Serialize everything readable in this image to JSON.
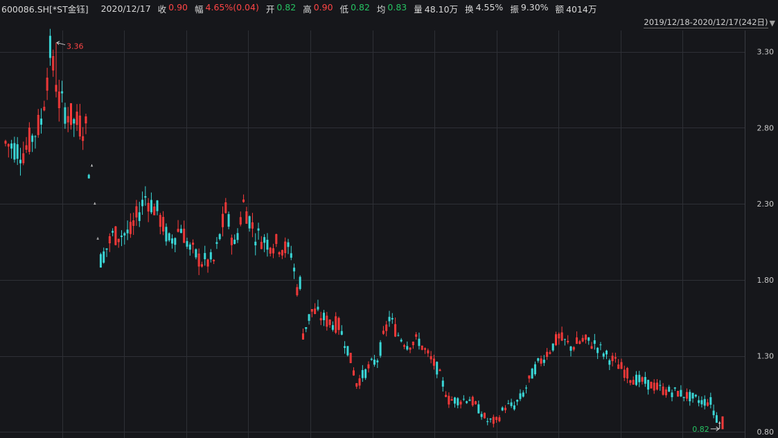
{
  "header": {
    "symbol": "600086.SH[*ST金钰]",
    "date": "2020/12/17",
    "fields": [
      {
        "label": "收",
        "value": "0.90",
        "tone": "up"
      },
      {
        "label": "幅",
        "value": "4.65%(0.04)",
        "tone": "up"
      },
      {
        "label": "开",
        "value": "0.82",
        "tone": "down"
      },
      {
        "label": "高",
        "value": "0.90",
        "tone": "up"
      },
      {
        "label": "低",
        "value": "0.82",
        "tone": "down"
      },
      {
        "label": "均",
        "value": "0.83",
        "tone": "down"
      },
      {
        "label": "量",
        "value": "48.10万",
        "tone": "neu"
      },
      {
        "label": "换",
        "value": "4.55%",
        "tone": "neu"
      },
      {
        "label": "振",
        "value": "9.30%",
        "tone": "neu"
      },
      {
        "label": "额",
        "value": "4014万",
        "tone": "neu"
      }
    ],
    "range_label": "2019/12/18-2020/12/17(242日)",
    "range_icon": "triangle-down-icon"
  },
  "colors": {
    "background": "#16171b",
    "grid": "#2e3036",
    "up": "#ff3b3b",
    "down": "#3ad6d6",
    "flat": "#e0e0e0",
    "max_label": "#ff4545",
    "min_label": "#26c262"
  },
  "chart_data": {
    "type": "candlestick",
    "ylim": [
      0.76,
      3.44
    ],
    "yticks": [
      "3.30",
      "2.80",
      "2.30",
      "1.80",
      "1.30",
      "0.80"
    ],
    "grid": true,
    "vertical_grid_count": 11,
    "max_label": "3.36",
    "min_label": "0.82",
    "anchors": [
      [
        0,
        2.7
      ],
      [
        6,
        2.64
      ],
      [
        12,
        2.84
      ],
      [
        15,
        3.3
      ],
      [
        18,
        2.98
      ],
      [
        23,
        2.84
      ],
      [
        27,
        2.8
      ],
      [
        28,
        2.55
      ],
      [
        29,
        2.3
      ],
      [
        30,
        2.07
      ],
      [
        32,
        1.93
      ],
      [
        36,
        2.09
      ],
      [
        42,
        2.11
      ],
      [
        47,
        2.35
      ],
      [
        51,
        2.25
      ],
      [
        55,
        2.05
      ],
      [
        59,
        2.15
      ],
      [
        62,
        2.0
      ],
      [
        66,
        1.92
      ],
      [
        70,
        1.92
      ],
      [
        74,
        2.25
      ],
      [
        77,
        2.02
      ],
      [
        80,
        2.3
      ],
      [
        84,
        2.1
      ],
      [
        88,
        2.05
      ],
      [
        92,
        2.03
      ],
      [
        96,
        1.98
      ],
      [
        98,
        1.75
      ],
      [
        100,
        1.45
      ],
      [
        103,
        1.6
      ],
      [
        108,
        1.53
      ],
      [
        112,
        1.5
      ],
      [
        115,
        1.35
      ],
      [
        118,
        1.12
      ],
      [
        122,
        1.22
      ],
      [
        125,
        1.28
      ],
      [
        129,
        1.55
      ],
      [
        132,
        1.44
      ],
      [
        135,
        1.38
      ],
      [
        139,
        1.4
      ],
      [
        142,
        1.3
      ],
      [
        145,
        1.22
      ],
      [
        149,
        1.01
      ],
      [
        153,
        1.01
      ],
      [
        156,
        1.02
      ],
      [
        159,
        0.95
      ],
      [
        162,
        0.87
      ],
      [
        165,
        0.87
      ],
      [
        168,
        0.97
      ],
      [
        171,
        0.97
      ],
      [
        174,
        1.05
      ],
      [
        178,
        1.22
      ],
      [
        182,
        1.32
      ],
      [
        186,
        1.42
      ],
      [
        190,
        1.36
      ],
      [
        194,
        1.4
      ],
      [
        198,
        1.38
      ],
      [
        202,
        1.3
      ],
      [
        206,
        1.24
      ],
      [
        210,
        1.16
      ],
      [
        214,
        1.13
      ],
      [
        218,
        1.1
      ],
      [
        222,
        1.07
      ],
      [
        226,
        1.06
      ],
      [
        230,
        1.03
      ],
      [
        234,
        1.0
      ],
      [
        238,
        1.0
      ],
      [
        241,
        0.98
      ]
    ],
    "special": [
      {
        "i": 17,
        "o": 3.04,
        "h": 3.36,
        "l": 3.0,
        "c": 3.08
      },
      {
        "i": 29,
        "o": 2.55,
        "h": 2.56,
        "l": 2.55,
        "c": 2.55
      },
      {
        "i": 30,
        "o": 2.3,
        "h": 2.31,
        "l": 2.3,
        "c": 2.3
      },
      {
        "i": 31,
        "o": 2.07,
        "h": 2.08,
        "l": 2.07,
        "c": 2.07
      },
      {
        "i": 99,
        "o": 1.82,
        "h": 1.83,
        "l": 1.73,
        "c": 1.74
      },
      {
        "i": 238,
        "o": 0.94,
        "h": 0.98,
        "l": 0.89,
        "c": 0.91
      },
      {
        "i": 239,
        "o": 0.91,
        "h": 0.93,
        "l": 0.86,
        "c": 0.86
      },
      {
        "i": 240,
        "o": 0.86,
        "h": 0.87,
        "l": 0.82,
        "c": 0.86
      },
      {
        "i": 241,
        "o": 0.82,
        "h": 0.9,
        "l": 0.82,
        "c": 0.9
      }
    ]
  }
}
